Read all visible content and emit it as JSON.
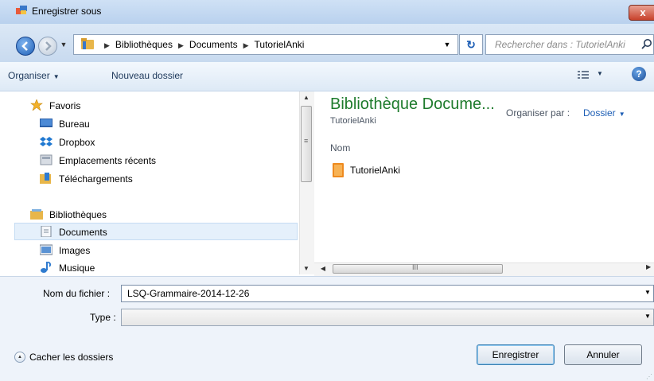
{
  "window": {
    "title": "Enregistrer sous",
    "close_glyph": "x"
  },
  "address": {
    "crumbs": [
      "Bibliothèques",
      "Documents",
      "TutorielAnki"
    ],
    "refresh_glyph": "↻"
  },
  "search": {
    "placeholder": "Rechercher dans : TutorielAnki"
  },
  "toolbar": {
    "organize_label": "Organiser",
    "new_folder_label": "Nouveau dossier",
    "help_glyph": "?"
  },
  "nav": {
    "favorites_label": "Favoris",
    "favorites": [
      "Bureau",
      "Dropbox",
      "Emplacements récents",
      "Téléchargements"
    ],
    "libraries_label": "Bibliothèques",
    "libraries": [
      "Documents",
      "Images",
      "Musique"
    ],
    "selected": "Documents"
  },
  "content": {
    "library_title": "Bibliothèque Docume...",
    "library_subtitle": "TutorielAnki",
    "arrange_label": "Organiser par :",
    "arrange_value": "Dossier",
    "column_name": "Nom",
    "files": [
      "TutorielAnki"
    ]
  },
  "form": {
    "filename_label": "Nom du fichier :",
    "filename_value": "LSQ-Grammaire-2014-12-26",
    "type_label": "Type :",
    "type_value": ""
  },
  "footer": {
    "hide_folders_label": "Cacher les dossiers",
    "save_label": "Enregistrer",
    "cancel_label": "Annuler"
  },
  "colors": {
    "accent": "#1d5eb5",
    "library_title": "#1e7b2c",
    "close_button": "#c8412b"
  },
  "icons": [
    "save-dialog-icon",
    "back-arrow-icon",
    "forward-arrow-icon",
    "folder-icon",
    "refresh-icon",
    "search-icon",
    "view-icon",
    "help-icon",
    "star-icon",
    "desktop-icon",
    "dropbox-icon",
    "recent-places-icon",
    "downloads-icon",
    "library-icon",
    "documents-icon",
    "images-icon",
    "music-icon",
    "folder-file-icon"
  ]
}
